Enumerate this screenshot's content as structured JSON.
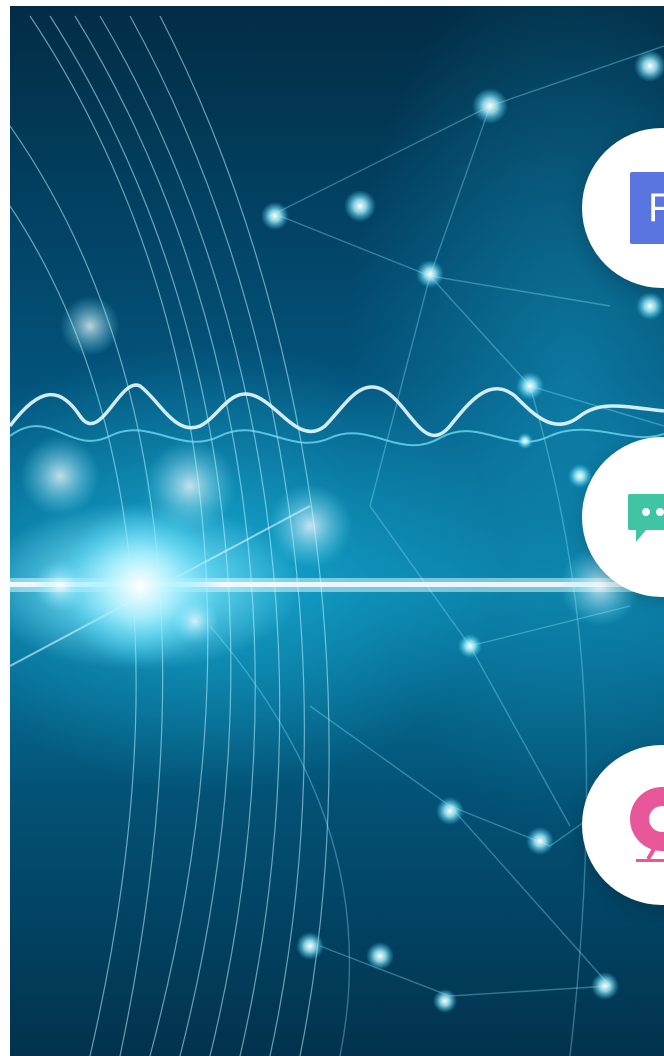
{
  "hero": {
    "icon": "fiber-optic-network-background"
  },
  "actions": [
    {
      "icon": "f-logo-icon",
      "label": "F",
      "color": "#5a74e0"
    },
    {
      "icon": "chat-bubble-icon",
      "color": "#3fc4a4"
    },
    {
      "icon": "webcam-icon",
      "color": "#e8579a"
    }
  ]
}
